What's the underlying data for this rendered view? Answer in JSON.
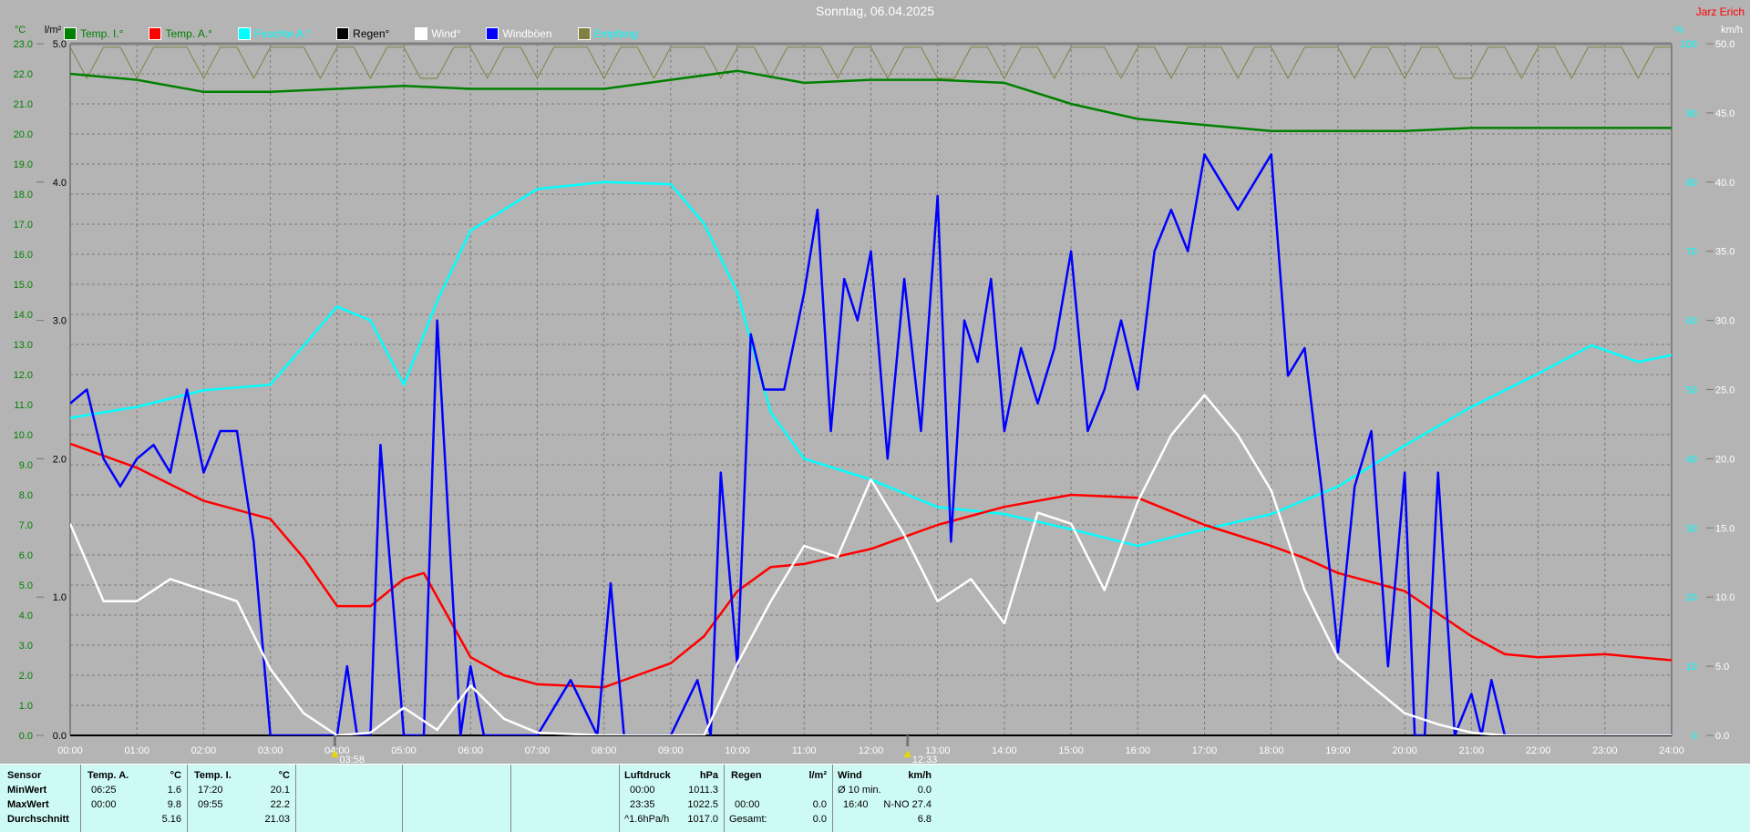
{
  "title": "Sonntag, 06.04.2025",
  "author": "Jarz Erich",
  "markers": [
    {
      "time": "03:58",
      "hour": 3.967
    },
    {
      "time": "12:33",
      "hour": 12.55
    }
  ],
  "chart_data": {
    "type": "line",
    "title": "Sonntag, 06.04.2025",
    "x_unit": "hour",
    "xlim": [
      0,
      24
    ],
    "x_ticks": [
      "00:00",
      "01:00",
      "02:00",
      "03:00",
      "04:00",
      "05:00",
      "06:00",
      "07:00",
      "08:00",
      "09:00",
      "10:00",
      "11:00",
      "12:00",
      "13:00",
      "14:00",
      "15:00",
      "16:00",
      "17:00",
      "18:00",
      "19:00",
      "20:00",
      "21:00",
      "22:00",
      "23:00",
      "24:00"
    ],
    "axes": {
      "temp": {
        "label": "°C",
        "range": [
          0,
          23
        ],
        "color": "#008000"
      },
      "rain": {
        "label": "l/m²",
        "range": [
          0,
          5
        ],
        "ticks": [
          "0.0",
          "1.0",
          "2.0",
          "3.0",
          "4.0",
          "5.0"
        ],
        "color": "#000000"
      },
      "humidity": {
        "label": "%",
        "range": [
          0,
          100
        ],
        "color": "#00ffff"
      },
      "wind": {
        "label": "km/h",
        "range": [
          0,
          50
        ],
        "color": "#ffffff"
      }
    },
    "grid": true,
    "legend_placement": "top-left",
    "series": [
      {
        "name": "Temp. I.°",
        "axis": "temp",
        "color": "#008000",
        "text_color": "#008000",
        "x": [
          0,
          1,
          2,
          3,
          4,
          5,
          6,
          7,
          8,
          9,
          10,
          11,
          12,
          13,
          14,
          15,
          16,
          17,
          18,
          19,
          20,
          21,
          22,
          23,
          24
        ],
        "y": [
          22.0,
          21.8,
          21.4,
          21.4,
          21.5,
          21.6,
          21.5,
          21.5,
          21.5,
          21.8,
          22.1,
          21.7,
          21.8,
          21.8,
          21.7,
          21.0,
          20.5,
          20.3,
          20.1,
          20.1,
          20.1,
          20.2,
          20.2,
          20.2,
          20.2
        ]
      },
      {
        "name": "Temp. A.°",
        "axis": "temp",
        "color": "#ff0000",
        "text_color": "#008000",
        "x": [
          0,
          1,
          2,
          3,
          3.5,
          4,
          4.5,
          5,
          5.3,
          6,
          6.5,
          7,
          8,
          8.5,
          9,
          9.5,
          10,
          10.5,
          11,
          12,
          13,
          14,
          15,
          16,
          17,
          18,
          18.5,
          19,
          20,
          21,
          21.5,
          22,
          23,
          24
        ],
        "y": [
          9.7,
          8.9,
          7.8,
          7.2,
          5.9,
          4.3,
          4.3,
          5.2,
          5.4,
          2.6,
          2.0,
          1.7,
          1.6,
          2.0,
          2.4,
          3.3,
          4.8,
          5.6,
          5.7,
          6.2,
          7.0,
          7.6,
          8.0,
          7.9,
          7.0,
          6.3,
          5.9,
          5.4,
          4.8,
          3.3,
          2.7,
          2.6,
          2.7,
          2.5
        ]
      },
      {
        "name": "Feuchte A.°",
        "axis": "humidity",
        "color": "#00ffff",
        "text_color": "#00ffff",
        "x": [
          0,
          1,
          2,
          3,
          4,
          4.5,
          5,
          5.5,
          6,
          7,
          8,
          9,
          9.5,
          10,
          10.5,
          11,
          12,
          13,
          14,
          15,
          16,
          17,
          18,
          19,
          20,
          21,
          22,
          22.8,
          23.5,
          24
        ],
        "y": [
          45.9,
          47.5,
          49.9,
          50.7,
          62,
          60,
          50.7,
          62.8,
          73,
          79,
          80,
          79.7,
          74,
          64,
          46.7,
          40,
          37,
          33,
          32,
          29.8,
          27.4,
          29.8,
          32,
          36,
          41.9,
          47.5,
          52.3,
          56.4,
          54,
          55
        ]
      },
      {
        "name": "Regen°",
        "axis": "rain",
        "color": "#000000",
        "text_color": "#000000",
        "x": [
          0,
          24
        ],
        "y": [
          0,
          0
        ]
      },
      {
        "name": "Wind°",
        "axis": "wind",
        "color": "#ffffff",
        "text_color": "#ffffff",
        "x": [
          0,
          0.5,
          1,
          1.5,
          2,
          2.5,
          3,
          3.5,
          4,
          4.5,
          5,
          5.5,
          6,
          6.5,
          7,
          8,
          9,
          9.5,
          10,
          10.5,
          11,
          11.5,
          12,
          12.5,
          13,
          13.5,
          14,
          14.5,
          15,
          15.5,
          16,
          16.5,
          17,
          17.5,
          18,
          18.5,
          19,
          19.5,
          20,
          20.5,
          21,
          21.5,
          24
        ],
        "y": [
          15.3,
          9.7,
          9.7,
          11.3,
          10.5,
          9.7,
          4.8,
          1.6,
          0,
          0.2,
          2,
          0.4,
          3.6,
          1.2,
          0.2,
          0,
          0,
          0,
          5.2,
          9.7,
          13.7,
          12.9,
          18.5,
          14.5,
          9.7,
          11.3,
          8.1,
          16.1,
          15.3,
          10.5,
          16.9,
          21.7,
          24.6,
          21.7,
          17.7,
          10.5,
          5.6,
          3.6,
          1.6,
          0.8,
          0.2,
          0,
          0
        ]
      },
      {
        "name": "Windböen",
        "axis": "wind",
        "color": "#0000ff",
        "text_color": "#ffffff",
        "x": [
          0,
          0.25,
          0.5,
          0.75,
          1,
          1.25,
          1.5,
          1.75,
          2,
          2.25,
          2.5,
          2.75,
          3,
          3.5,
          4,
          4.15,
          4.3,
          4.5,
          4.65,
          5,
          5.3,
          5.5,
          5.85,
          6,
          6.2,
          6.4,
          7,
          7.5,
          7.9,
          8.1,
          8.3,
          8.5,
          9,
          9.4,
          9.6,
          9.75,
          10,
          10.2,
          10.4,
          10.7,
          11,
          11.2,
          11.4,
          11.6,
          11.8,
          12,
          12.25,
          12.5,
          12.75,
          13,
          13.2,
          13.4,
          13.6,
          13.8,
          14,
          14.25,
          14.5,
          14.75,
          15,
          15.25,
          15.5,
          15.75,
          16,
          16.25,
          16.5,
          16.75,
          17,
          17.25,
          17.5,
          17.75,
          18,
          18.25,
          18.5,
          18.75,
          19,
          19.25,
          19.5,
          19.75,
          20,
          20.15,
          20.3,
          20.5,
          20.75,
          21,
          21.15,
          21.3,
          21.5,
          21.75,
          24
        ],
        "y": [
          24,
          25,
          20,
          18,
          20,
          21,
          19,
          25,
          19,
          22,
          22,
          14,
          0,
          0,
          0,
          5,
          0,
          0,
          21,
          0,
          0,
          30,
          0,
          5,
          0,
          0,
          0,
          4,
          0,
          11,
          0,
          0,
          0,
          4,
          0,
          19,
          5,
          29,
          25,
          25,
          32,
          38,
          22,
          33,
          30,
          35,
          20,
          33,
          22,
          39,
          14,
          30,
          27,
          33,
          22,
          28,
          24,
          28,
          35,
          22,
          25,
          30,
          25,
          35,
          38,
          35,
          42,
          40,
          38,
          40,
          42,
          26,
          28,
          18,
          6,
          18,
          22,
          5,
          19,
          0,
          0,
          19,
          0,
          3,
          0,
          4,
          0,
          0,
          0
        ]
      },
      {
        "name": "Empfang",
        "axis": "humidity",
        "color": "#808040",
        "text_color": "#00ffff",
        "x": [
          0,
          24
        ],
        "y": [
          99,
          99
        ]
      }
    ]
  },
  "table": {
    "sensor": {
      "header": "Sensor",
      "rows": [
        "MinWert",
        "MaxWert",
        "Durchschnitt"
      ]
    },
    "temp_a": {
      "header": "Temp. A.",
      "unit": "°C",
      "min_time": "06:25",
      "min": "1.6",
      "max_time": "00:00",
      "max": "9.8",
      "avg": "5.16"
    },
    "temp_i": {
      "header": "Temp. I.",
      "unit": "°C",
      "min_time": "17:20",
      "min": "20.1",
      "max_time": "09:55",
      "max": "22.2",
      "avg": "21.03"
    },
    "pressure": {
      "header": "Luftdruck",
      "unit": "hPa",
      "min_time": "00:00",
      "min": "1011.3",
      "max_time": "23:35",
      "max": "1022.5",
      "trend": "^1.6hPa/h",
      "avg": "1017.0"
    },
    "rain": {
      "header": "Regen",
      "unit": "l/m²",
      "max_time": "00:00",
      "max": "0.0",
      "total_label": "Gesamt:",
      "total": "0.0"
    },
    "wind": {
      "header": "Wind",
      "unit": "km/h",
      "avg10_label": "Ø 10 min.",
      "avg10": "0.0",
      "max_time": "16:40",
      "max": "N-NO 27.4",
      "avg": "6.8"
    }
  }
}
